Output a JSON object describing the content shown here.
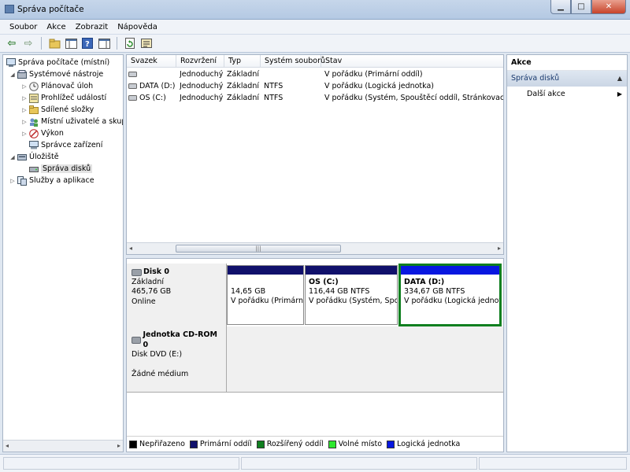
{
  "window": {
    "title": "Správa počítače"
  },
  "menu": [
    "Soubor",
    "Akce",
    "Zobrazit",
    "Nápověda"
  ],
  "tree": [
    {
      "label": "Správa počítače (místní)",
      "level": 0,
      "expand": "",
      "icon": "computer-management-icon"
    },
    {
      "label": "Systémové nástroje",
      "level": 1,
      "expand": "◢",
      "icon": "system-tools-icon"
    },
    {
      "label": "Plánovač úloh",
      "level": 2,
      "expand": "▷",
      "icon": "task-scheduler-icon"
    },
    {
      "label": "Prohlížeč událostí",
      "level": 2,
      "expand": "▷",
      "icon": "event-viewer-icon"
    },
    {
      "label": "Sdílené složky",
      "level": 2,
      "expand": "▷",
      "icon": "shared-folders-icon"
    },
    {
      "label": "Místní uživatelé a skupiny",
      "level": 2,
      "expand": "▷",
      "icon": "local-users-icon"
    },
    {
      "label": "Výkon",
      "level": 2,
      "expand": "▷",
      "icon": "performance-icon"
    },
    {
      "label": "Správce zařízení",
      "level": 2,
      "expand": "",
      "icon": "device-manager-icon"
    },
    {
      "label": "Úložiště",
      "level": 1,
      "expand": "◢",
      "icon": "storage-icon"
    },
    {
      "label": "Správa disků",
      "level": 2,
      "expand": "",
      "icon": "disk-management-icon",
      "selected": true
    },
    {
      "label": "Služby a aplikace",
      "level": 1,
      "expand": "▷",
      "icon": "services-apps-icon"
    }
  ],
  "volumes": {
    "columns": [
      "Svazek",
      "Rozvržení",
      "Typ",
      "Systém souborů",
      "Stav"
    ],
    "rows": [
      [
        "",
        "Jednoduchý",
        "Základní",
        "",
        "V pořádku (Primární oddíl)"
      ],
      [
        "DATA (D:)",
        "Jednoduchý",
        "Základní",
        "NTFS",
        "V pořádku (Logická jednotka)"
      ],
      [
        "OS (C:)",
        "Jednoduchý",
        "Základní",
        "NTFS",
        "V pořádku (Systém, Spouštěcí oddíl, Stránkovací soubor, Aktivní, Výpis stavu systému, Primární oddíl)"
      ]
    ]
  },
  "disks": [
    {
      "name": "Disk 0",
      "type": "Základní",
      "size": "465,76 GB",
      "status": "Online"
    },
    {
      "name": "Jednotka CD-ROM 0",
      "type": "Disk DVD (E:)",
      "status": "Žádné médium"
    }
  ],
  "partitions": [
    {
      "name": "",
      "size": "14,65 GB",
      "status": "V pořádku (Primární oddíl)"
    },
    {
      "name": "OS  (C:)",
      "size": "116,44 GB NTFS",
      "status": "V pořádku (Systém, Spouštěcí oddíl)"
    },
    {
      "name": "DATA  (D:)",
      "size": "334,67 GB NTFS",
      "status": "V pořádku (Logická jednotka)"
    }
  ],
  "legend": [
    {
      "label": "Nepřiřazeno",
      "color": "#000000"
    },
    {
      "label": "Primární oddíl",
      "color": "#10106b"
    },
    {
      "label": "Rozšířený oddíl",
      "color": "#0f7f1f"
    },
    {
      "label": "Volné místo",
      "color": "#2ee82e"
    },
    {
      "label": "Logická jednotka",
      "color": "#0717e0"
    }
  ],
  "actions": {
    "header": "Akce",
    "section": "Správa disků",
    "item": "Další akce"
  }
}
